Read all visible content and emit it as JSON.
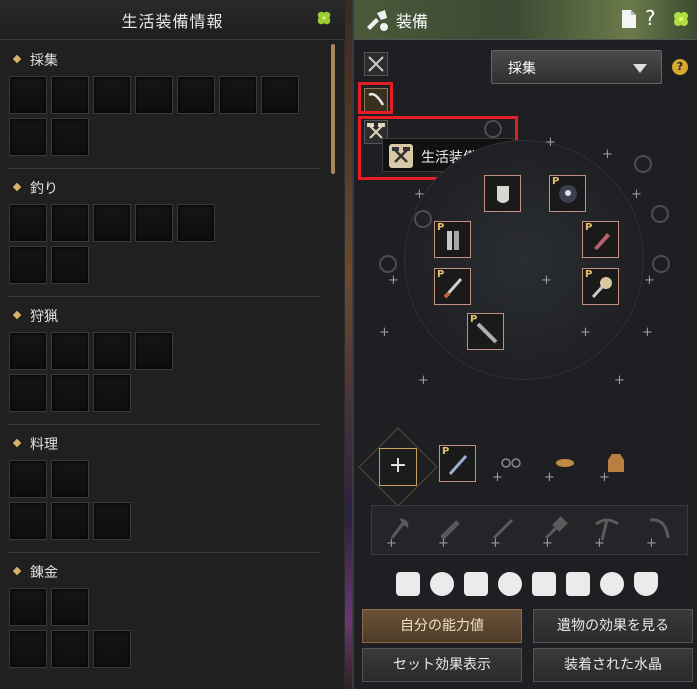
{
  "left_panel": {
    "title": "生活装備情報",
    "categories": [
      {
        "label": "採集",
        "slots": 9
      },
      {
        "label": "釣り",
        "slots": 7
      },
      {
        "label": "狩猟",
        "slots": 7
      },
      {
        "label": "料理",
        "slots": 5
      },
      {
        "label": "錬金",
        "slots": 5
      }
    ]
  },
  "right_panel": {
    "title": "装備",
    "dropdown": {
      "selected": "採集"
    },
    "tooltip": {
      "label": "生活装備情報"
    },
    "p_badge": "P",
    "add_slot": "+",
    "help": "?",
    "dd_help": "?",
    "buttons": {
      "stats": "自分の能力値",
      "artifact": "遺物の効果を見る",
      "set_effect": "セット効果表示",
      "crystal": "装着された水晶"
    }
  },
  "colors": {
    "highlight": "#e31e26",
    "accent": "#c8a060",
    "scroll_thumb": "#a8865a",
    "header_green": "#4a5a3a"
  },
  "icons": [
    "clover-icon",
    "equipment-icon",
    "page-icon",
    "help-icon",
    "crossed-swords-icon",
    "pickaxe-icon",
    "hammer-icon",
    "axe-icon",
    "knife-icon",
    "sickle-icon"
  ]
}
